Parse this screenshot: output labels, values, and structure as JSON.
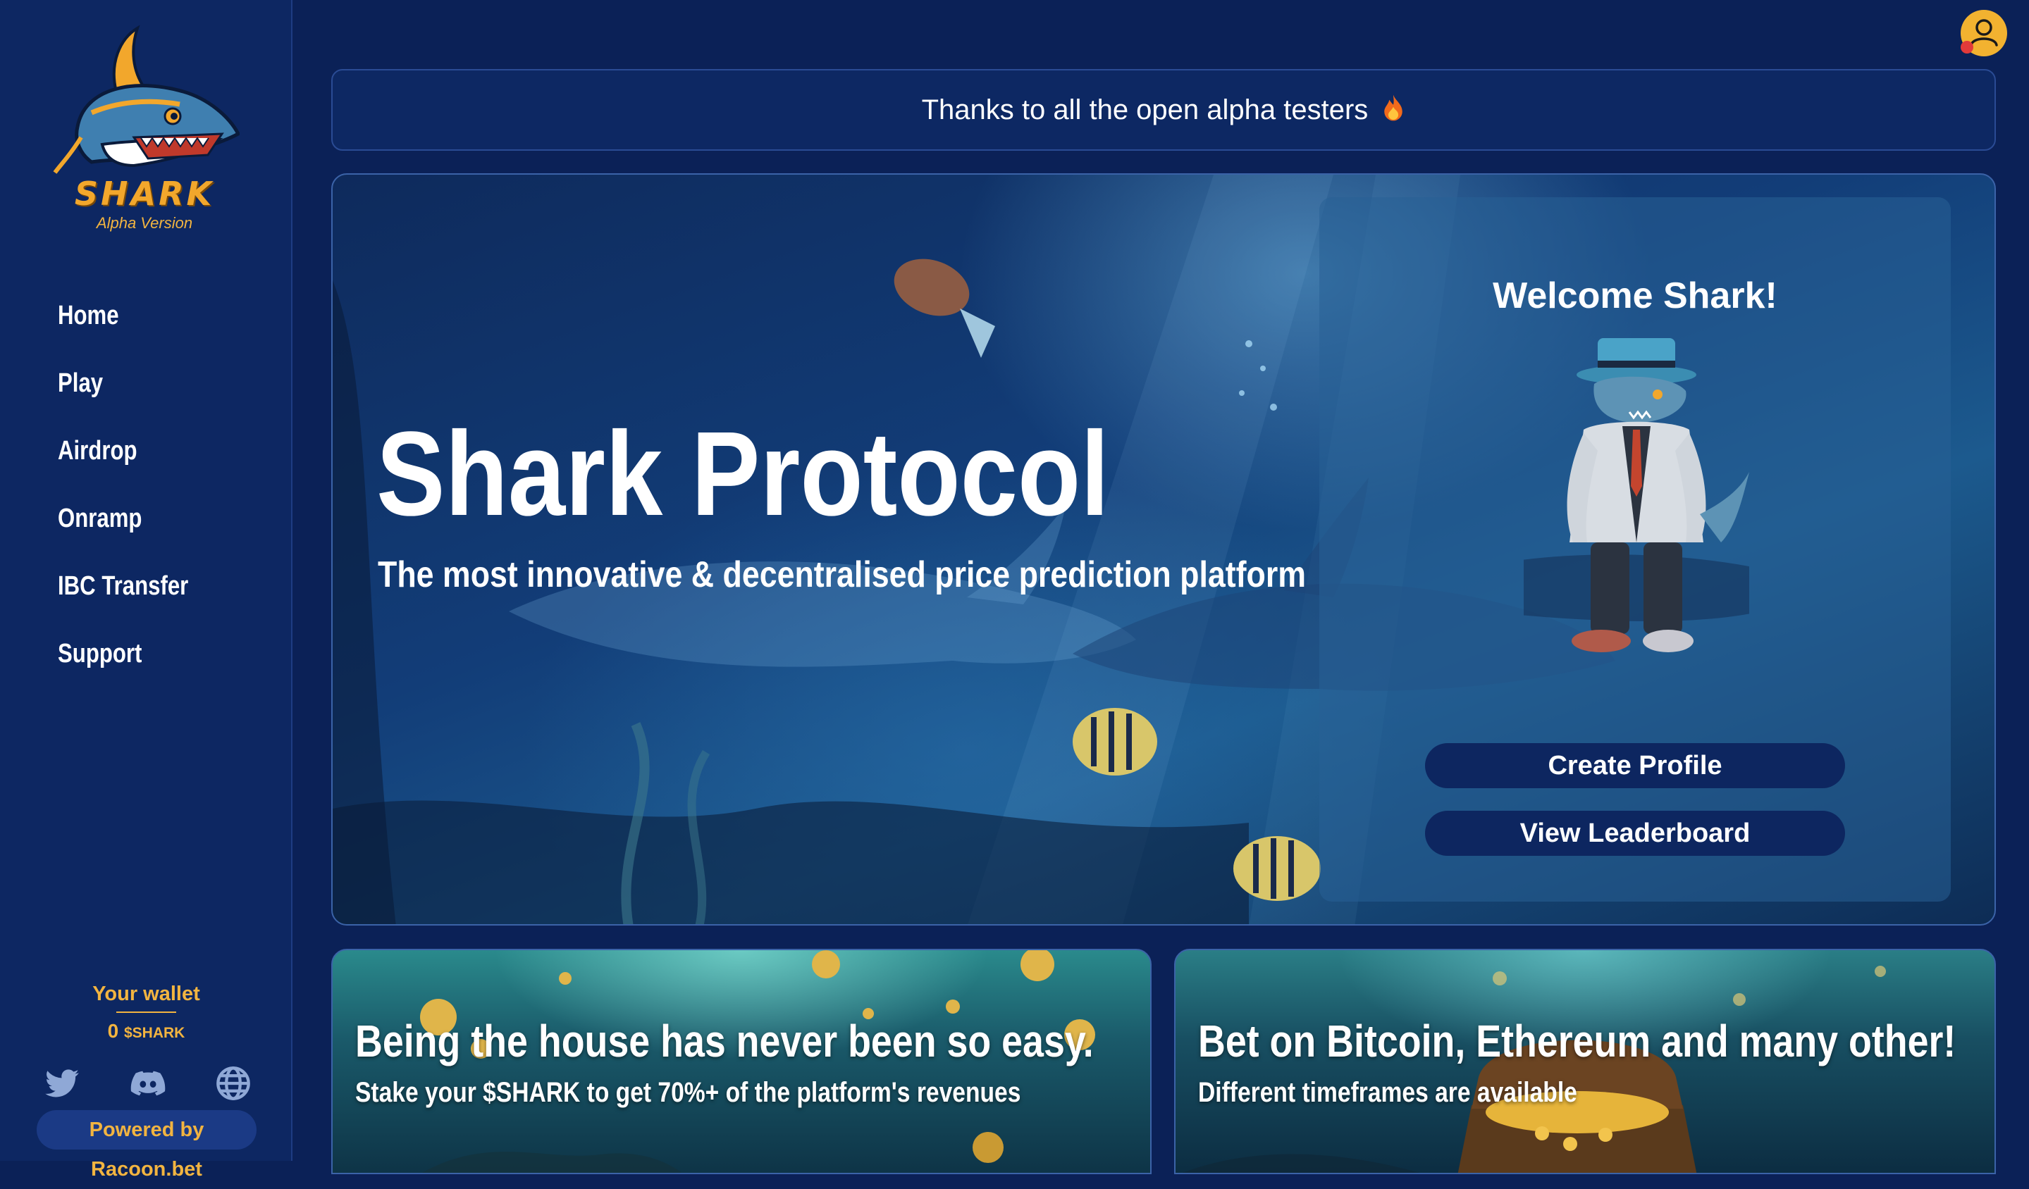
{
  "app": {
    "logo_text": "SHARK",
    "logo_subtitle": "Alpha Version",
    "colors": {
      "background": "#0b2157",
      "sidebar": "#0d2762",
      "accent_gold": "#f2b440",
      "button_dark": "#0d2660"
    }
  },
  "sidebar": {
    "items": [
      {
        "label": "Home"
      },
      {
        "label": "Play"
      },
      {
        "label": "Airdrop"
      },
      {
        "label": "Onramp"
      },
      {
        "label": "IBC Transfer"
      },
      {
        "label": "Support"
      }
    ],
    "wallet": {
      "title": "Your wallet",
      "balance": "0",
      "unit": "$SHARK"
    },
    "socials": [
      {
        "icon": "twitter-icon"
      },
      {
        "icon": "discord-icon"
      },
      {
        "icon": "globe-icon"
      }
    ],
    "powered_by": "Powered by Racoon.bet"
  },
  "header": {
    "avatar_icon": "user-icon",
    "banner_text": "Thanks to all the open alpha testers",
    "banner_icon": "fire-icon"
  },
  "hero": {
    "title": "Shark Protocol",
    "subtitle": "The most innovative & decentralised price prediction platform",
    "card": {
      "title": "Welcome Shark!",
      "create_profile": "Create Profile",
      "view_leaderboard": "View Leaderboard"
    }
  },
  "features": [
    {
      "title": "Being the house has never been so easy.",
      "subtitle": "Stake your $SHARK to get 70%+ of the platform's revenues"
    },
    {
      "title": "Bet on Bitcoin, Ethereum and many other!",
      "subtitle": "Different timeframes are available"
    }
  ]
}
